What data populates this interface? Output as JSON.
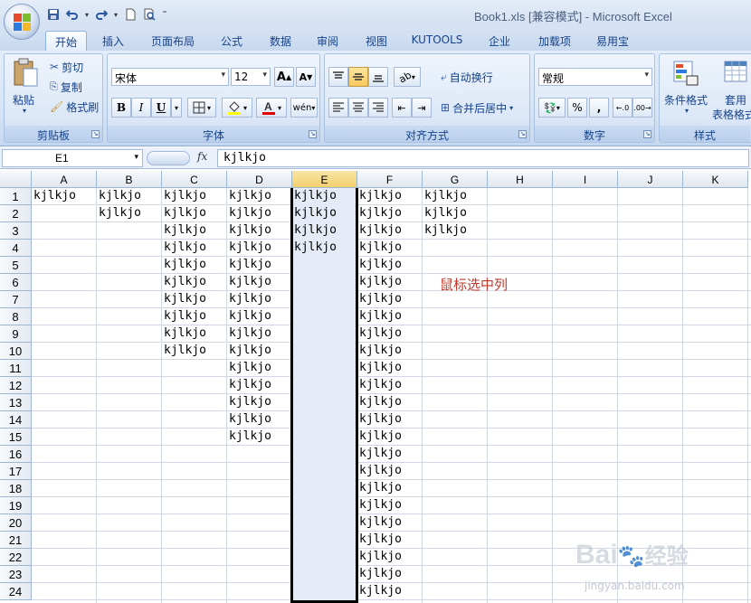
{
  "window": {
    "title": "Book1.xls  [兼容模式] - Microsoft Excel"
  },
  "qat": {
    "icons": [
      "save-icon",
      "undo-icon",
      "redo-icon",
      "new-icon",
      "print-preview-icon",
      "customize-icon"
    ]
  },
  "ribbon": {
    "tabs": [
      "开始",
      "插入",
      "页面布局",
      "公式",
      "数据",
      "审阅",
      "视图",
      "KUTOOLS",
      "企业",
      "加载项",
      "易用宝"
    ],
    "active_tab": "开始",
    "clipboard": {
      "paste": "粘贴",
      "cut": "剪切",
      "copy": "复制",
      "format_painter": "格式刷",
      "label": "剪贴板"
    },
    "font": {
      "name": "宋体",
      "size": "12",
      "grow": "A",
      "shrink": "A",
      "bold": "B",
      "italic": "I",
      "underline": "U",
      "label": "字体",
      "font_color": "#e00000",
      "fill_color": "#ffff00"
    },
    "alignment": {
      "wrap_text": "自动换行",
      "merge_center": "合并后居中",
      "label": "对齐方式"
    },
    "number": {
      "format": "常规",
      "percent": "%",
      "comma": ",",
      "label": "数字"
    },
    "styles": {
      "conditional": "条件格式",
      "table_format_1": "套用",
      "table_format_2": "表格格式",
      "label": "样式"
    }
  },
  "formula_bar": {
    "name_box": "E1",
    "fx": "fx",
    "value": "kjlkjo"
  },
  "sheet": {
    "columns": [
      "A",
      "B",
      "C",
      "D",
      "E",
      "F",
      "G",
      "H",
      "I",
      "J",
      "K"
    ],
    "selected_column": "E",
    "rows": [
      "1",
      "2",
      "3",
      "4",
      "5",
      "6",
      "7",
      "8",
      "9",
      "10",
      "11",
      "12",
      "13",
      "14",
      "15",
      "16",
      "17",
      "18",
      "19",
      "20",
      "21",
      "22",
      "23",
      "24"
    ],
    "cell_text": "kjlkjo",
    "filled_rows_by_column": {
      "A": 1,
      "B": 2,
      "C": 10,
      "D": 15,
      "E": 4,
      "F": 24,
      "G": 3
    },
    "annotation": "鼠标选中列"
  },
  "watermark": {
    "brand": "Bai",
    "brand2": "经验",
    "url": "jingyan.baidu.com"
  }
}
